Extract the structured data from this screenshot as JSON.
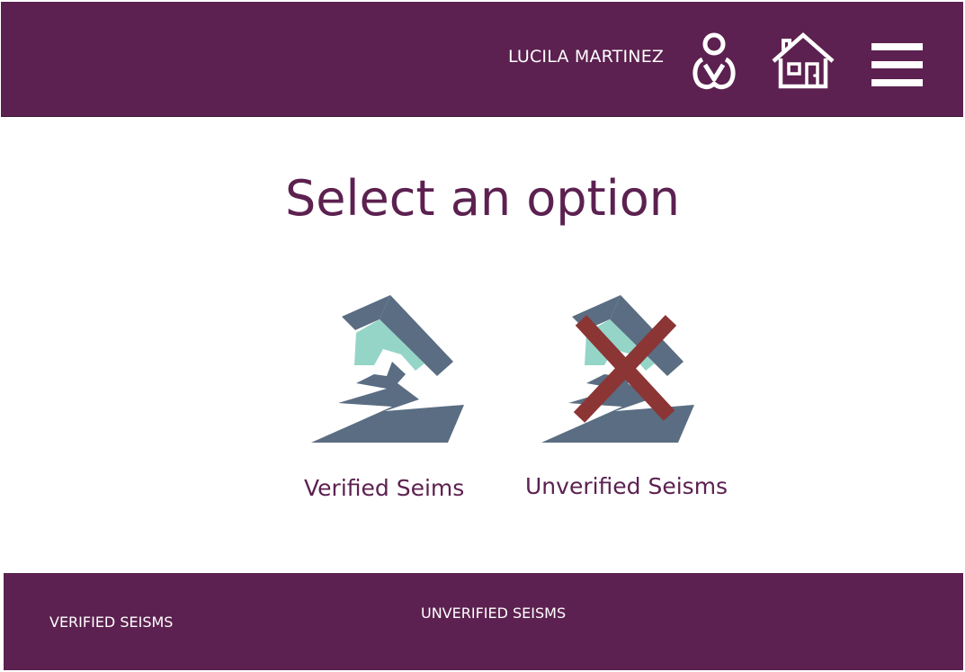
{
  "header": {
    "user_name": "LUCILA MARTINEZ",
    "icons": [
      "user-icon",
      "home-icon",
      "hamburger-menu-icon"
    ]
  },
  "main": {
    "title": "Select an option",
    "options": [
      {
        "label": "Verified Seims",
        "icon": "earthquake-house-icon"
      },
      {
        "label": "Unverified Seisms",
        "icon": "earthquake-house-crossed-icon"
      }
    ]
  },
  "footer": {
    "links": [
      {
        "label": "VERIFIED SEISMS"
      },
      {
        "label": "UNVERIFIED SEISMS"
      }
    ]
  },
  "colors": {
    "brand": "#5c2150",
    "house_slate": "#5a6d82",
    "house_mint": "#95d5c8",
    "cross": "#8b3535"
  }
}
